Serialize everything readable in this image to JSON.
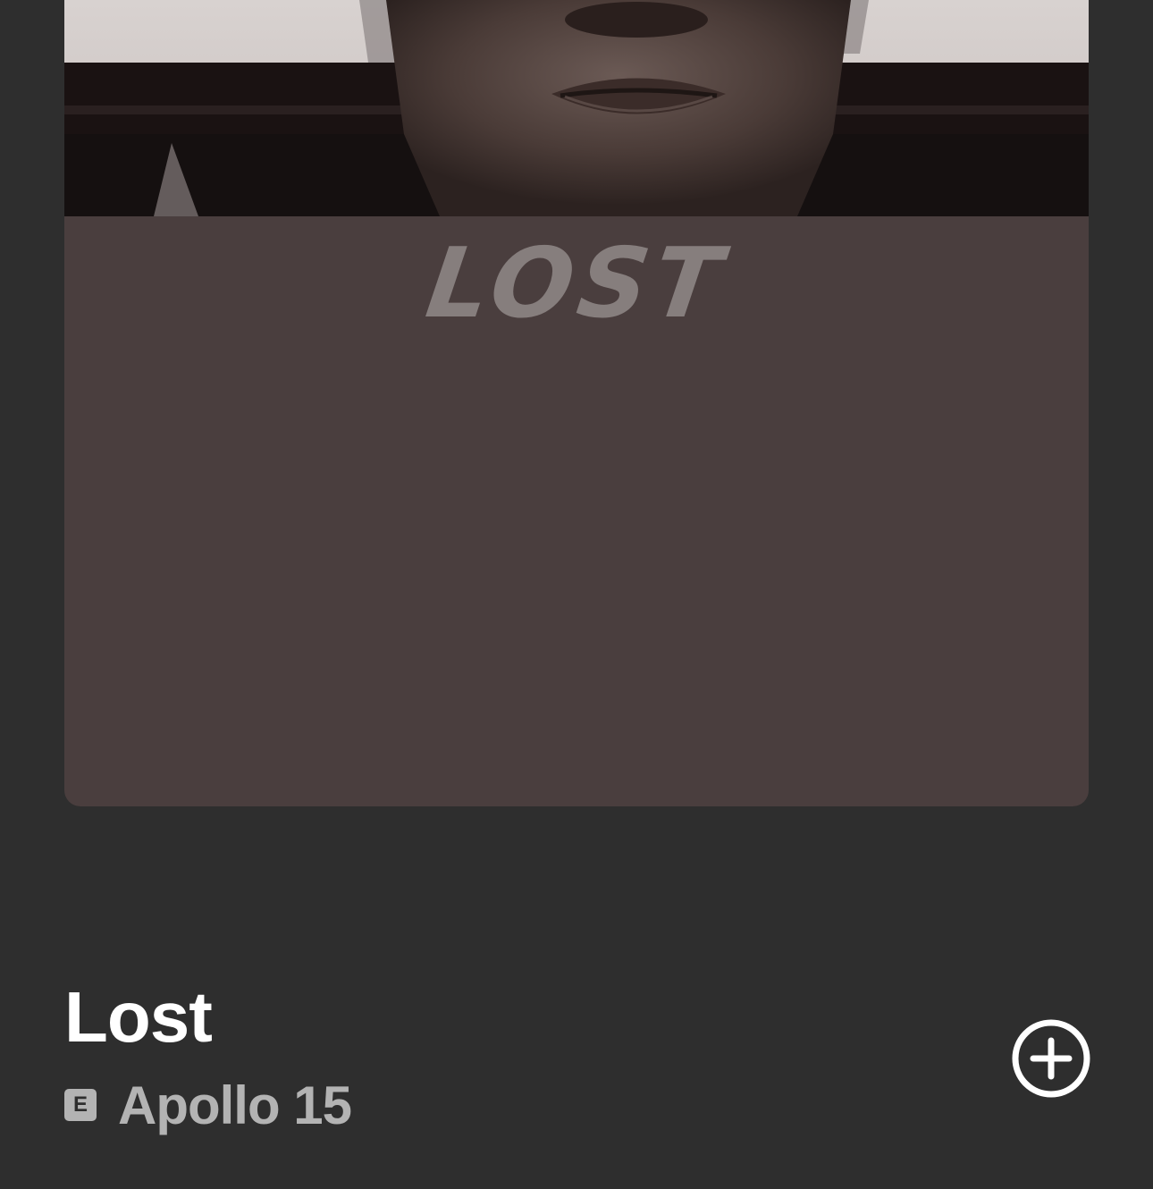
{
  "cover": {
    "artwork_text": "LOST"
  },
  "track": {
    "title": "Lost",
    "explicit_label": "E",
    "artist": "Apollo 15"
  },
  "colors": {
    "background": "#2e2e2e",
    "cover_fill": "#4a3e3e",
    "title": "#ffffff",
    "secondary": "#b3b3b3"
  },
  "icons": {
    "add": "plus-circle-icon"
  }
}
